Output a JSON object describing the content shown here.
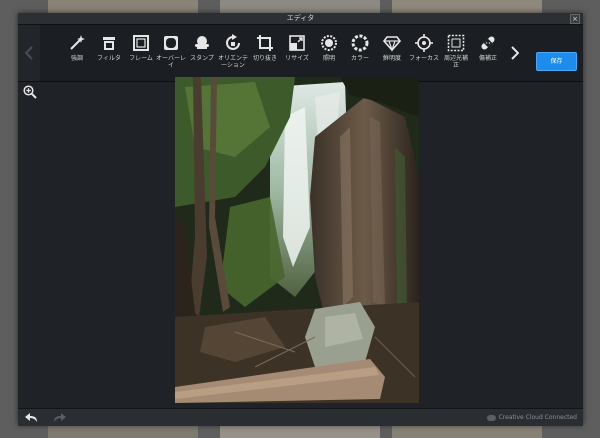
{
  "window": {
    "title": "エディタ",
    "close_label": "×"
  },
  "toolbar": {
    "tools": [
      {
        "id": "enhance",
        "label": "強調",
        "icon": "magic-wand-icon"
      },
      {
        "id": "filter",
        "label": "フィルタ",
        "icon": "filter-icon"
      },
      {
        "id": "frame",
        "label": "フレーム",
        "icon": "frame-icon"
      },
      {
        "id": "overlay",
        "label": "オーバーレ\nイ",
        "icon": "overlay-icon"
      },
      {
        "id": "stamp",
        "label": "スタンプ",
        "icon": "stamp-icon"
      },
      {
        "id": "orientation",
        "label": "オリエンテ\nーション",
        "icon": "rotate-icon"
      },
      {
        "id": "crop",
        "label": "切り抜き",
        "icon": "crop-icon"
      },
      {
        "id": "resize",
        "label": "リサイズ",
        "icon": "resize-icon"
      },
      {
        "id": "lighting",
        "label": "照明",
        "icon": "lighting-icon"
      },
      {
        "id": "color",
        "label": "カラー",
        "icon": "color-icon"
      },
      {
        "id": "sharpness",
        "label": "鮮明度",
        "icon": "diamond-icon"
      },
      {
        "id": "focus",
        "label": "フォーカス",
        "icon": "focus-icon"
      },
      {
        "id": "vignette",
        "label": "周辺光補\n正",
        "icon": "vignette-icon"
      },
      {
        "id": "blemish",
        "label": "傷補正",
        "icon": "bandage-icon"
      }
    ],
    "save_label": "保存"
  },
  "status": {
    "cc_label": "Creative Cloud Connected"
  },
  "colors": {
    "accent": "#1d8ded",
    "window_bg": "#1f2328",
    "toolbar_bg": "#1b1e22"
  }
}
